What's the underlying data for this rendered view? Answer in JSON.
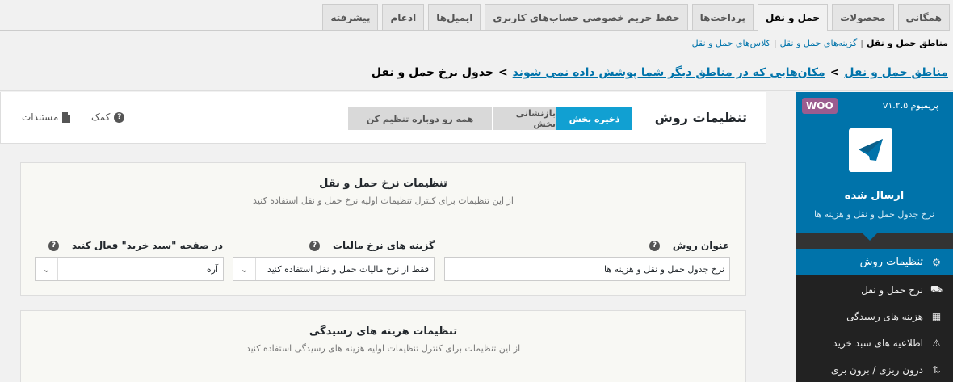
{
  "tabs": [
    {
      "label": "همگانی",
      "active": false
    },
    {
      "label": "محصولات",
      "active": false
    },
    {
      "label": "حمل و نقل",
      "active": true
    },
    {
      "label": "پرداخت‌ها",
      "active": false
    },
    {
      "label": "حفظ حریم خصوصی حساب‌های کاربری",
      "active": false
    },
    {
      "label": "ایمیل‌ها",
      "active": false
    },
    {
      "label": "ادغام",
      "active": false
    },
    {
      "label": "پیشرفته",
      "active": false
    }
  ],
  "sublinks": {
    "current": "مناطق حمل و نقل",
    "sep": "|",
    "options": "گزینه‌های حمل و نقل",
    "classes": "کلاس‌های حمل و نقل"
  },
  "breadcrumb": {
    "zones": "مناطق حمل و نقل",
    "other": "مکان‌هایی که در مناطق دیگر شما پوشش داده نمی شوند",
    "sep": ">",
    "current": "جدول نرخ حمل و نقل"
  },
  "header": {
    "title": "تنظیمات روش",
    "save": "ذخیره بخش",
    "reset": "بازنشانی بخش",
    "reset_all": "همه رو دوباره تنظیم کن",
    "help": "کمک",
    "docs": "مستندات"
  },
  "section1": {
    "title": "تنظیمات نرخ حمل و نقل",
    "desc": "از این تنظیمات برای کنترل تنظیمات اولیه نرخ حمل و نقل استفاده کنید",
    "field1_label": "عنوان روش",
    "field1_value": "نرخ جدول حمل و نقل و هزینه ها",
    "field2_label": "گزینه های نرخ مالیات",
    "field2_value": "فقط از نرخ مالیات حمل و نقل استفاده کنید",
    "field3_label": "در صفحه \"سبد خرید\" فعال کنید",
    "field3_value": "آره"
  },
  "section2": {
    "title": "تنظیمات هزینه های رسیدگی",
    "desc": "از این تنظیمات برای کنترل تنظیمات اولیه هزینه های رسیدگی استفاده کنید"
  },
  "sidebar": {
    "woo": "WOO",
    "version": "پریمیوم v۱.۲.۵",
    "name": "ارسال شده",
    "subtitle": "نرخ جدول حمل و نقل و هزینه ها",
    "items": [
      {
        "label": "تنظیمات روش",
        "icon": "gear-icon"
      },
      {
        "label": "نرخ حمل و نقل",
        "icon": "truck-icon"
      },
      {
        "label": "هزینه های رسیدگی",
        "icon": "box-icon"
      },
      {
        "label": "اطلاعیه های سبد خرید",
        "icon": "alert-icon"
      },
      {
        "label": "درون ریزی / برون بری",
        "icon": "import-export-icon"
      }
    ]
  },
  "help_glyph": "?",
  "colors": {
    "accent": "#0073aa",
    "save": "#11a0d2",
    "woo": "#9b5c8f"
  }
}
